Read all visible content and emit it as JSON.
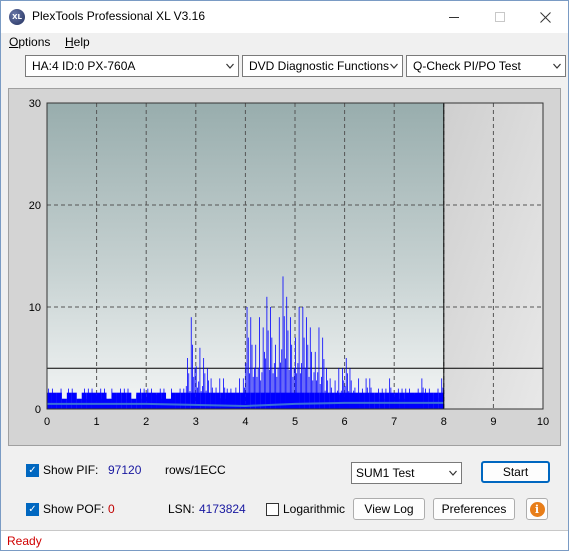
{
  "window": {
    "title": "PlexTools Professional XL V3.16",
    "icon_label": "XL"
  },
  "menu": {
    "options": "Options",
    "options_accel": "O",
    "options_rest": "ptions",
    "help": "Help",
    "help_accel": "H",
    "help_rest": "elp"
  },
  "toolbar": {
    "drive": "HA:4 ID:0  PX-760A",
    "function": "DVD Diagnostic Functions",
    "test": "Q-Check PI/PO Test"
  },
  "chart_data": {
    "type": "bar",
    "title": "",
    "xlabel": "",
    "ylabel": "",
    "xlim": [
      0,
      10
    ],
    "ylim": [
      0,
      30
    ],
    "x_ticks": [
      "0",
      "1",
      "2",
      "3",
      "4",
      "5",
      "6",
      "7",
      "8",
      "9",
      "10"
    ],
    "y_ticks": [
      "0",
      "10",
      "20",
      "30"
    ],
    "grid": true,
    "threshold": 4,
    "end_marker_x": 8,
    "series": [
      {
        "kind": "pif-bars",
        "color": "#0000ff",
        "x": [
          0.0,
          0.1,
          0.2,
          0.3,
          0.4,
          0.5,
          0.6,
          0.7,
          0.8,
          0.9,
          1.0,
          1.1,
          1.2,
          1.3,
          1.4,
          1.5,
          1.6,
          1.7,
          1.8,
          1.9,
          2.0,
          2.1,
          2.2,
          2.3,
          2.4,
          2.5,
          2.6,
          2.7,
          2.8,
          2.9,
          3.0,
          3.1,
          3.2,
          3.3,
          3.4,
          3.5,
          3.6,
          3.7,
          3.8,
          3.9,
          4.0,
          4.1,
          4.2,
          4.3,
          4.4,
          4.5,
          4.6,
          4.7,
          4.8,
          4.9,
          5.0,
          5.1,
          5.2,
          5.3,
          5.4,
          5.5,
          5.6,
          5.7,
          5.8,
          5.9,
          6.0,
          6.1,
          6.2,
          6.3,
          6.4,
          6.5,
          6.6,
          6.7,
          6.8,
          6.9,
          7.0,
          7.1,
          7.2,
          7.3,
          7.4,
          7.5,
          7.6,
          7.7,
          7.8,
          7.9
        ],
        "values": [
          2,
          2,
          2,
          1,
          2,
          2,
          1,
          2,
          2,
          2,
          2,
          2,
          1,
          2,
          2,
          2,
          2,
          1,
          2,
          2,
          2,
          2,
          2,
          2,
          1,
          2,
          2,
          2,
          5,
          9,
          6,
          5,
          4,
          3,
          3,
          3,
          2,
          2,
          3,
          3,
          10,
          9,
          9,
          8,
          11,
          10,
          9,
          13,
          11,
          9,
          10,
          10,
          9,
          8,
          8,
          7,
          4,
          3,
          4,
          4,
          5,
          4,
          3,
          2,
          3,
          3,
          2,
          2,
          2,
          3,
          2,
          2,
          2,
          2,
          2,
          3,
          2,
          2,
          2,
          3
        ]
      },
      {
        "kind": "pif-baseline",
        "color": "#3a6fd8",
        "x": [
          0,
          2,
          4,
          5,
          6,
          7,
          8
        ],
        "values": [
          0.5,
          0.5,
          0.3,
          0.5,
          0.6,
          0.6,
          0.6
        ]
      }
    ]
  },
  "stats": {
    "show_pif_label": "Show PIF:",
    "pif_value": "97120",
    "pif_unit": "rows/1ECC",
    "show_pof_label": "Show POF:",
    "pof_value": "0",
    "lsn_label": "LSN:",
    "lsn_value": "4173824",
    "logarithmic_label": "Logarithmic"
  },
  "controls": {
    "sum_select": "SUM1 Test",
    "start": "Start",
    "view_log": "View Log",
    "preferences": "Preferences",
    "info_glyph": "i"
  },
  "status": {
    "text": "Ready"
  },
  "colors": {
    "chart_bg_top": "#a9bcbc",
    "chart_bg_bottom": "#ffffff",
    "bar": "#0000ff",
    "status_text": "#d00000"
  }
}
